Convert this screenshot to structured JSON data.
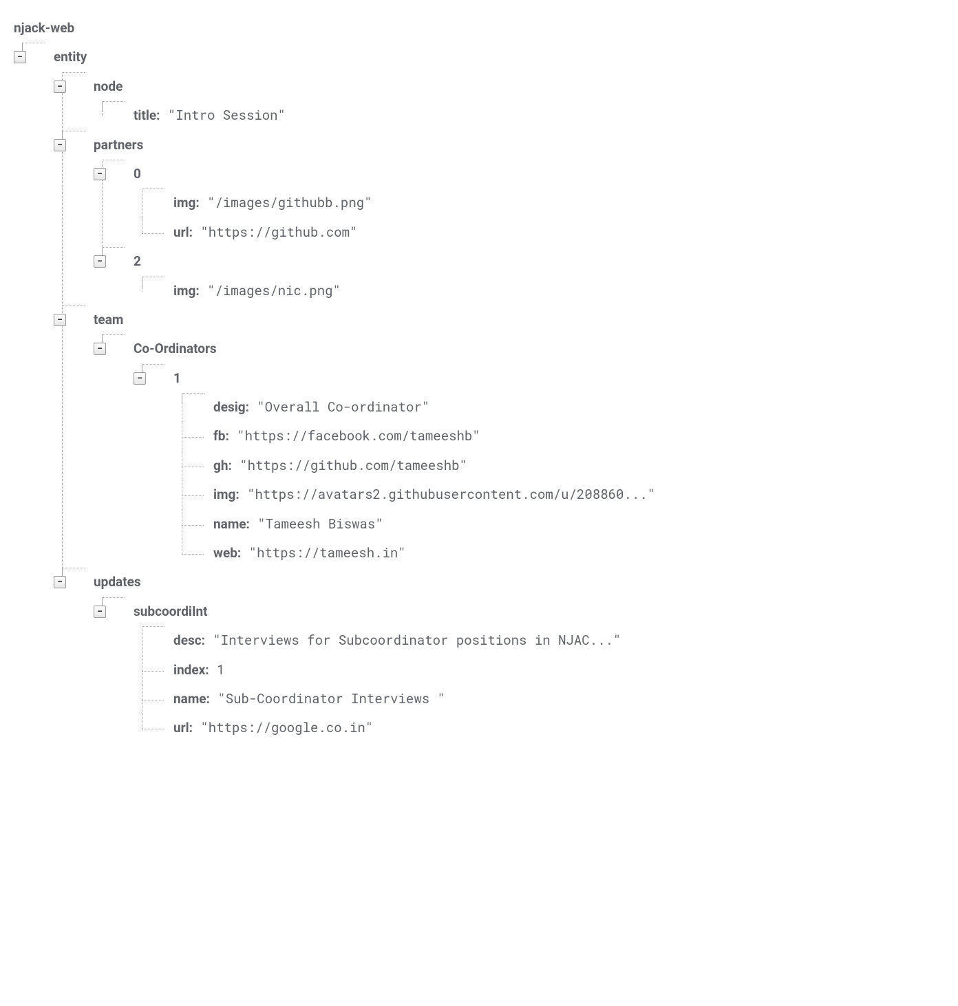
{
  "tree": {
    "root": "njack-web",
    "entity": {
      "label": "entity",
      "node": {
        "label": "node",
        "title_key": "title:",
        "title_val": " \"Intro Session\""
      },
      "partners": {
        "label": "partners",
        "items": [
          {
            "idx": "0",
            "img_key": "img:",
            "img_val": " \"/images/githubb.png\"",
            "url_key": "url:",
            "url_val": " \"https://github.com\""
          },
          {
            "idx": "2",
            "img_key": "img:",
            "img_val": " \"/images/nic.png\""
          }
        ]
      },
      "team": {
        "label": "team",
        "coordinators": {
          "label": "Co-Ordinators",
          "items": [
            {
              "idx": "1",
              "desig_key": "desig:",
              "desig_val": " \"Overall Co-ordinator\"",
              "fb_key": "fb:",
              "fb_val": " \"https://facebook.com/tameeshb\"",
              "gh_key": "gh:",
              "gh_val": " \"https://github.com/tameeshb\"",
              "img_key": "img:",
              "img_val": " \"https://avatars2.githubusercontent.com/u/208860...\"",
              "name_key": "name:",
              "name_val": " \"Tameesh Biswas\"",
              "web_key": "web:",
              "web_val": " \"https://tameesh.in\""
            }
          ]
        }
      },
      "updates": {
        "label": "updates",
        "subcoordiInt": {
          "label": "subcoordiInt",
          "desc_key": "desc:",
          "desc_val": " \"Interviews for Subcoordinator positions in NJAC...\"",
          "index_key": "index:",
          "index_val": " 1",
          "name_key": "name:",
          "name_val": " \"Sub-Coordinator Interviews \"",
          "url_key": "url:",
          "url_val": " \"https://google.co.in\""
        }
      }
    }
  }
}
